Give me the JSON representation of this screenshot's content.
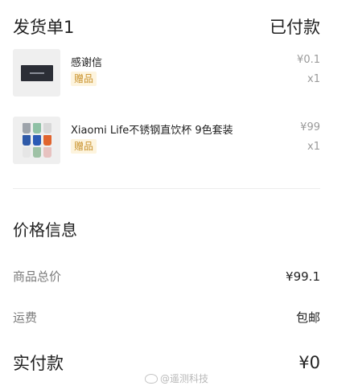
{
  "header": {
    "title": "发货单1",
    "status": "已付款"
  },
  "items": [
    {
      "name": "感谢信",
      "badge": "赠品",
      "price": "¥0.1",
      "qty": "x1",
      "image_icon": "thank-you-card-icon"
    },
    {
      "name": "Xiaomi Life不锈钢直饮杯 9色套装",
      "badge": "赠品",
      "price": "¥99",
      "qty": "x1",
      "image_icon": "cup-set-icon",
      "cup_colors": [
        "#9ea4ab",
        "#8fc1a5",
        "#d8d8d8",
        "#2f5aa8",
        "#2b5bb5",
        "#e0642e",
        "#e6e6e6",
        "#9fc2a6",
        "#e7c2c0"
      ]
    }
  ],
  "price_info": {
    "title": "价格信息",
    "subtotal_label": "商品总价",
    "subtotal_value": "¥99.1",
    "shipping_label": "运费",
    "shipping_value": "包邮",
    "total_label": "实付款",
    "total_value": "¥0"
  },
  "watermark": {
    "text": "@遥测科技"
  }
}
